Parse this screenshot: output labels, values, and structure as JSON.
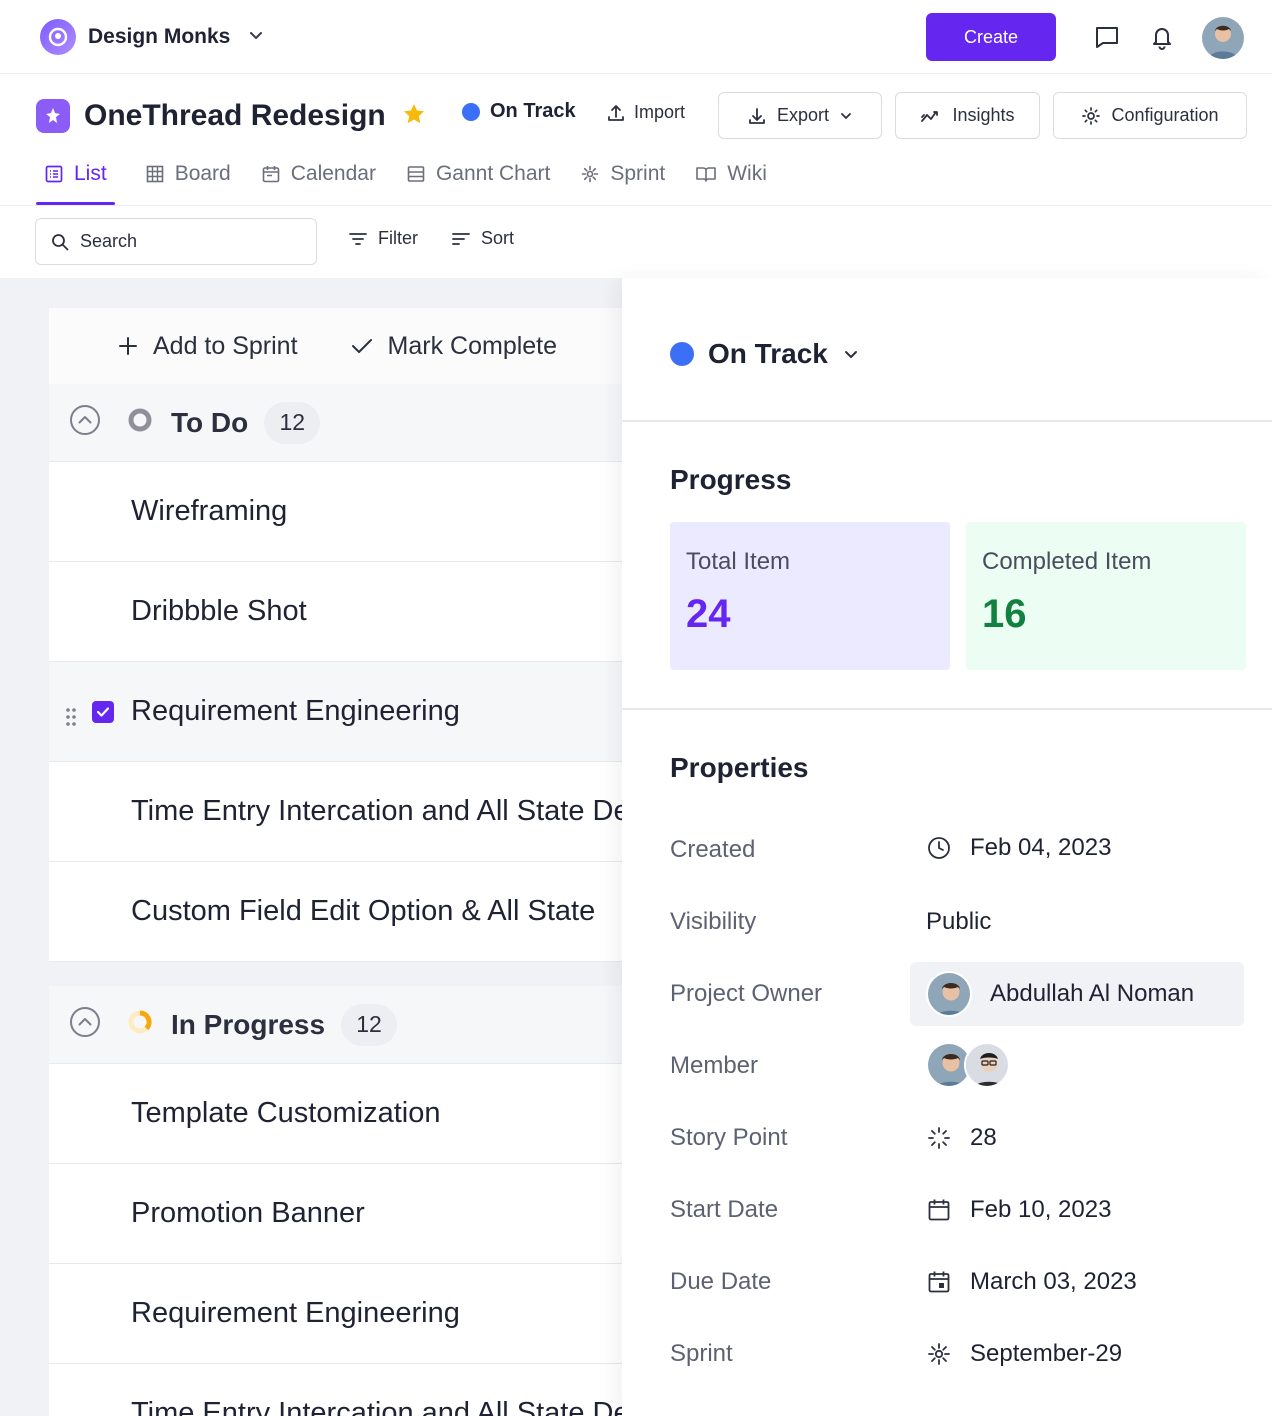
{
  "workspace": {
    "name": "Design Monks"
  },
  "topbar": {
    "create_label": "Create"
  },
  "project": {
    "title": "OneThread Redesign",
    "status": "On Track",
    "status_color": "#3b6ff6"
  },
  "header_actions": {
    "import": "Import",
    "export": "Export",
    "insights": "Insights",
    "configuration": "Configuration"
  },
  "tabs": [
    {
      "label": "List",
      "icon": "list-icon",
      "active": true
    },
    {
      "label": "Board",
      "icon": "board-icon"
    },
    {
      "label": "Calendar",
      "icon": "calendar-icon"
    },
    {
      "label": "Gannt Chart",
      "icon": "gantt-icon"
    },
    {
      "label": "Sprint",
      "icon": "sprint-icon"
    },
    {
      "label": "Wiki",
      "icon": "wiki-icon"
    }
  ],
  "toolbar": {
    "search_placeholder": "Search",
    "filter": "Filter",
    "sort": "Sort"
  },
  "bulk_actions": {
    "add_to_sprint": "Add to Sprint",
    "mark_complete": "Mark Complete"
  },
  "groups": [
    {
      "title": "To Do",
      "count": "12",
      "tasks": [
        "Wireframing",
        "Dribbble Shot",
        "Requirement Engineering",
        "Time Entry Intercation and All State Design",
        "Custom Field Edit Option & All State"
      ]
    },
    {
      "title": "In Progress",
      "count": "12",
      "tasks": [
        "Template Customization",
        "Promotion Banner",
        "Requirement Engineering",
        "Time Entry Intercation and All State Design"
      ]
    }
  ],
  "panel": {
    "status": "On Track",
    "progress_title": "Progress",
    "total_label": "Total Item",
    "total_value": "24",
    "completed_label": "Completed Item",
    "completed_value": "16",
    "properties_title": "Properties",
    "props": {
      "created_label": "Created",
      "created_value": "Feb 04, 2023",
      "visibility_label": "Visibility",
      "visibility_value": "Public",
      "owner_label": "Project Owner",
      "owner_value": "Abdullah Al Noman",
      "member_label": "Member",
      "story_label": "Story Point",
      "story_value": "28",
      "start_label": "Start Date",
      "start_value": "Feb 10, 2023",
      "due_label": "Due Date",
      "due_value": "March 03, 2023",
      "sprint_label": "Sprint",
      "sprint_value": "September-29"
    }
  },
  "colors": {
    "accent": "#6527f0",
    "status_blue": "#3b6ff6",
    "total_bg": "#eceaff",
    "total_text": "#6527f0",
    "completed_bg": "#ecfdf3",
    "completed_text": "#12813f"
  }
}
